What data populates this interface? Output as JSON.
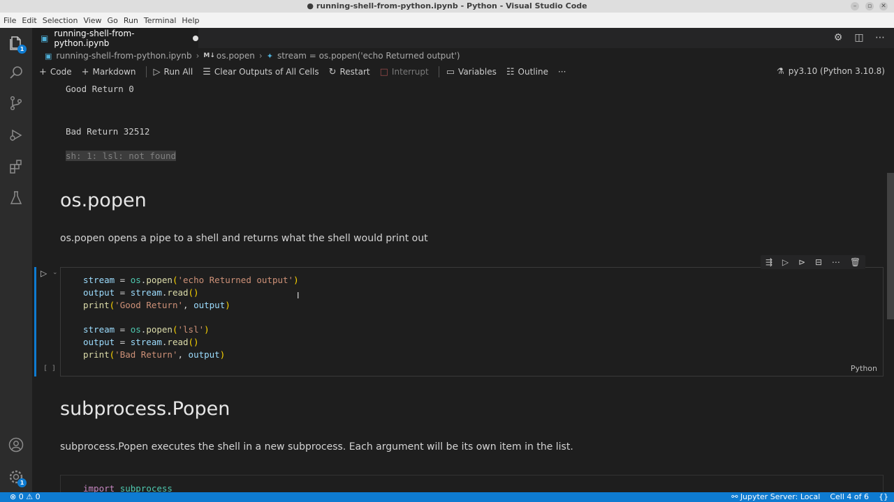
{
  "window": {
    "title": "● running-shell-from-python.ipynb - Python - Visual Studio Code",
    "controls": [
      "–",
      "▫",
      "✕"
    ]
  },
  "menu": [
    "File",
    "Edit",
    "Selection",
    "View",
    "Go",
    "Run",
    "Terminal",
    "Help"
  ],
  "activity_bar": {
    "explorer_badge": "1",
    "manage_badge": "1"
  },
  "tab": {
    "label": "running-shell-from-python.ipynb"
  },
  "breadcrumb": {
    "file": "running-shell-from-python.ipynb",
    "md_prefix": "M↓",
    "section": "os.popen",
    "symbol": "stream = os.popen('echo Returned output')"
  },
  "toolbar": {
    "code": "Code",
    "markdown": "Markdown",
    "run_all": "Run All",
    "clear_outputs": "Clear Outputs of All Cells",
    "restart": "Restart",
    "interrupt": "Interrupt",
    "variables": "Variables",
    "outline": "Outline",
    "more": "···",
    "kernel": "py3.10 (Python 3.10.8)"
  },
  "output": {
    "good": "Good Return  0",
    "bad": "Bad Return  32512",
    "stderr": "sh: 1: lsl: not found"
  },
  "markdown1": {
    "heading": "os.popen",
    "text": "os.popen opens a pipe to a shell and returns what the shell would print out"
  },
  "cell": {
    "execution_count": "[ ]",
    "language": "Python"
  },
  "markdown2": {
    "heading": "subprocess.Popen",
    "text": "subprocess.Popen executes the shell in a new subprocess. Each argument will be its own item in the list."
  },
  "cell2": {
    "first_line": "import subprocess"
  },
  "statusbar": {
    "errors": "0",
    "warnings": "0",
    "jupyter": "Jupyter Server: Local",
    "cell_position": "Cell 4 of 6"
  }
}
